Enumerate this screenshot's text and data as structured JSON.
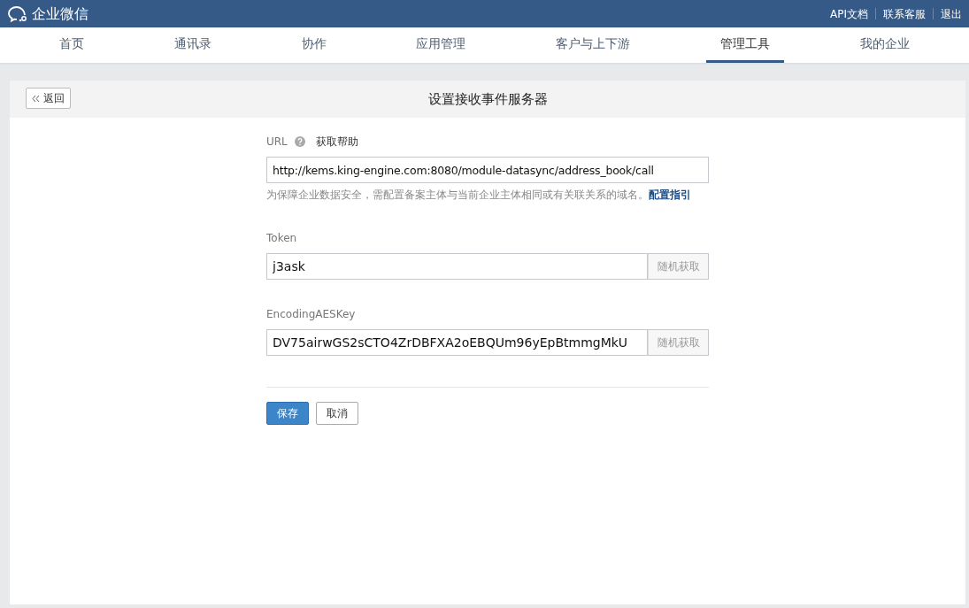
{
  "brand": "企业微信",
  "top_links": [
    "API文档",
    "联系客服",
    "退出"
  ],
  "nav": [
    {
      "label": "首页",
      "selected": false
    },
    {
      "label": "通讯录",
      "selected": false
    },
    {
      "label": "协作",
      "selected": false
    },
    {
      "label": "应用管理",
      "selected": false
    },
    {
      "label": "客户与上下游",
      "selected": false
    },
    {
      "label": "管理工具",
      "selected": true
    },
    {
      "label": "我的企业",
      "selected": false
    }
  ],
  "back_button": "返回",
  "page_title": "设置接收事件服务器",
  "form": {
    "url_label": "URL",
    "help_link": "获取帮助",
    "url_value": "http://kems.king-engine.com:8080/module-datasync/address_book/call",
    "hint": "为保障企业数据安全，需配置备案主体与当前企业主体相同或有关联关系的域名。",
    "hint_link": "配置指引",
    "fields": [
      {
        "label": "Token",
        "value": "j3ask",
        "button": "随机获取"
      },
      {
        "label": "EncodingAESKey",
        "value": "DV75airwGS2sCTO4ZrDBFXA2oEBQUm96yEpBtmmgMkU",
        "button": "随机获取"
      }
    ],
    "save": "保存",
    "cancel": "取消"
  }
}
